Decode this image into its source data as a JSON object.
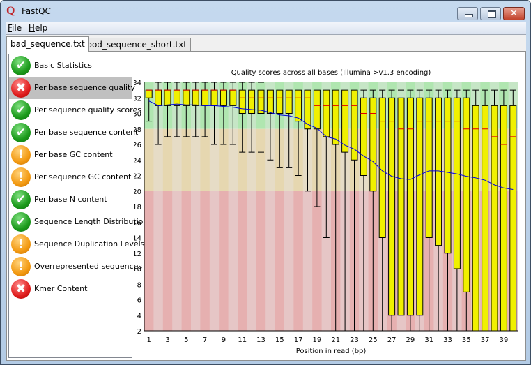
{
  "window": {
    "title": "FastQC",
    "app_icon": "fastqc-logo",
    "controls": [
      "minimize",
      "maximize",
      "close"
    ]
  },
  "menu": [
    {
      "label": "File",
      "mnemonic": "F"
    },
    {
      "label": "Help",
      "mnemonic": "H"
    }
  ],
  "tabs": [
    {
      "label": "bad_sequence.txt",
      "active": true
    },
    {
      "label": "good_sequence_short.txt",
      "active": false
    }
  ],
  "modules": [
    {
      "label": "Basic Statistics",
      "status": "pass"
    },
    {
      "label": "Per base sequence quality",
      "status": "fail",
      "selected": true
    },
    {
      "label": "Per sequence quality scores",
      "status": "pass"
    },
    {
      "label": "Per base sequence content",
      "status": "pass"
    },
    {
      "label": "Per base GC content",
      "status": "warn"
    },
    {
      "label": "Per sequence GC content",
      "status": "warn"
    },
    {
      "label": "Per base N content",
      "status": "pass"
    },
    {
      "label": "Sequence Length Distribution",
      "status": "pass"
    },
    {
      "label": "Sequence Duplication Levels",
      "status": "warn"
    },
    {
      "label": "Overrepresented sequences",
      "status": "warn"
    },
    {
      "label": "Kmer Content",
      "status": "fail"
    }
  ],
  "colors": {
    "box": "#f0f000",
    "median": "#e00000",
    "mean": "#0000e0",
    "good_band": [
      "#b0e6b0",
      "#c6e6c6"
    ],
    "warn_band": [
      "#e6d7b0",
      "#e6dcc6"
    ],
    "bad_band": [
      "#e6b0b0",
      "#e6c6c6"
    ]
  },
  "chart_data": {
    "type": "boxplot",
    "title": "Quality scores across all bases (Illumina >v1.3 encoding)",
    "xlabel": "Position in read (bp)",
    "ylabel": "",
    "ylim": [
      2,
      34
    ],
    "yticks": [
      2,
      4,
      6,
      8,
      10,
      12,
      14,
      16,
      18,
      20,
      22,
      24,
      26,
      28,
      30,
      32,
      34
    ],
    "xticks": [
      1,
      3,
      5,
      7,
      9,
      11,
      13,
      15,
      17,
      19,
      21,
      23,
      25,
      27,
      29,
      31,
      33,
      35,
      37,
      39
    ],
    "bands": {
      "good": [
        28,
        34
      ],
      "warn": [
        20,
        28
      ],
      "bad": [
        2,
        20
      ]
    },
    "positions": [
      1,
      2,
      3,
      4,
      5,
      6,
      7,
      8,
      9,
      10,
      11,
      12,
      13,
      14,
      15,
      16,
      17,
      18,
      19,
      20,
      21,
      22,
      23,
      24,
      25,
      26,
      27,
      28,
      29,
      30,
      31,
      32,
      33,
      34,
      35,
      36,
      37,
      38,
      39,
      40
    ],
    "whisker_high": [
      33,
      34,
      34,
      34,
      34,
      34,
      34,
      34,
      34,
      34,
      34,
      34,
      34,
      33,
      33,
      33,
      33,
      33,
      33,
      33,
      33,
      33,
      33,
      33,
      33,
      33,
      33,
      33,
      33,
      33,
      33,
      33,
      33,
      33,
      33,
      33,
      33,
      33,
      33,
      33
    ],
    "q3": [
      33,
      33,
      33,
      33,
      33,
      33,
      33,
      33,
      33,
      33,
      33,
      33,
      33,
      33,
      33,
      33,
      33,
      33,
      33,
      33,
      33,
      33,
      33,
      32,
      32,
      32,
      32,
      32,
      32,
      32,
      32,
      32,
      32,
      32,
      32,
      31,
      31,
      31,
      31,
      31
    ],
    "median": [
      33,
      33,
      33,
      33,
      33,
      33,
      33,
      33,
      33,
      33,
      32,
      32,
      32,
      32,
      32,
      32,
      32,
      32,
      31,
      31,
      31,
      31,
      31,
      30,
      30,
      29,
      29,
      28,
      28,
      29,
      29,
      29,
      29,
      29,
      28,
      28,
      28,
      27,
      26,
      27
    ],
    "q1": [
      32,
      31,
      31,
      31,
      31,
      31,
      31,
      31,
      31,
      31,
      30,
      30,
      30,
      30,
      30,
      30,
      29,
      28,
      28,
      27,
      26,
      25,
      24,
      22,
      20,
      14,
      4,
      4,
      4,
      4,
      14,
      13,
      12,
      10,
      7,
      2,
      2,
      2,
      2,
      2
    ],
    "whisker_low": [
      29,
      26,
      27,
      27,
      27,
      27,
      27,
      26,
      26,
      26,
      25,
      25,
      25,
      24,
      23,
      23,
      22,
      20,
      18,
      14,
      2,
      2,
      2,
      2,
      2,
      2,
      2,
      2,
      2,
      2,
      2,
      2,
      2,
      2,
      2,
      2,
      2,
      2,
      2,
      2
    ],
    "mean": [
      31.6,
      31.0,
      31.1,
      31.2,
      31.1,
      31.1,
      31.0,
      31.0,
      30.9,
      30.8,
      30.6,
      30.5,
      30.4,
      30.1,
      29.8,
      29.7,
      29.4,
      28.6,
      28.1,
      27.0,
      26.7,
      25.9,
      25.4,
      24.5,
      23.8,
      22.6,
      21.9,
      21.6,
      21.5,
      22.1,
      22.6,
      22.6,
      22.4,
      22.2,
      21.9,
      21.7,
      21.4,
      20.8,
      20.4,
      20.2
    ]
  }
}
